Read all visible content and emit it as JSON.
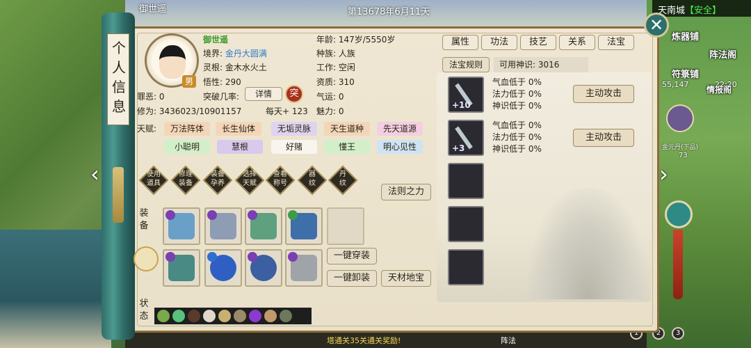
{
  "world": {
    "date": "第13678年6月11天",
    "player_tag": "御世遥",
    "bottom_notice": "塔通关35关通关奖励!",
    "bottom_tag": "阵法",
    "location": "天南城",
    "safety": "【安全】",
    "shops": [
      "炼器铺",
      "阵法阁",
      "符箓铺",
      "情报阁"
    ],
    "coords": "55,147",
    "time": "22:20",
    "npc_name": "金元丹(下品)",
    "npc_value": "73",
    "pages": [
      "1",
      "2",
      "3"
    ]
  },
  "panel_title": "个人信息",
  "character": {
    "name": "御世遥",
    "gender": "男",
    "realm_label": "境界:",
    "realm": "金丹大圆满",
    "root": "灵根: 金木水火土",
    "comprehension": "悟性: 290",
    "sin": "罪恶: 0",
    "breakthrough": "突破几率:",
    "detail_btn": "详情",
    "break_btn": "突",
    "cultivation": "修为: 3436023/10901157",
    "per_day": "每天+ 123",
    "age": "年龄: 147岁/5550岁",
    "race": "种族: 人族",
    "job": "工作: 空闲",
    "aptitude": "资质: 310",
    "luck": "气运: 0",
    "charm": "魅力: 0"
  },
  "talents": {
    "label": "天赋:",
    "items": [
      {
        "name": "万法阵体",
        "color": "#f3d6b8"
      },
      {
        "name": "长生仙体",
        "color": "#f3d6b8"
      },
      {
        "name": "无垢灵脉",
        "color": "#dfd4ef"
      },
      {
        "name": "天生道种",
        "color": "#f3d6b8"
      },
      {
        "name": "先天道源",
        "color": "#f3cfe0"
      },
      {
        "name": "小聪明",
        "color": "#d3efc9"
      },
      {
        "name": "慧根",
        "color": "#d9c9ec"
      },
      {
        "name": "好赌",
        "color": "#f8f5ee"
      },
      {
        "name": "懂王",
        "color": "#d3efc9"
      },
      {
        "name": "明心见性",
        "color": "#cfe3f2"
      }
    ]
  },
  "actions": [
    {
      "line1": "使用",
      "line2": "道具"
    },
    {
      "line1": "修理",
      "line2": "装备"
    },
    {
      "line1": "装备",
      "line2": "孕养"
    },
    {
      "line1": "选择",
      "line2": "天赋"
    },
    {
      "line1": "查看",
      "line2": "称号"
    },
    {
      "line1": "器",
      "line2": "纹"
    },
    {
      "line1": "丹",
      "line2": "纹"
    }
  ],
  "law_power": "法则之力",
  "equipment_label": "装备",
  "status_label": "状态",
  "one_click_wear": "一键穿装",
  "one_click_remove": "一键卸装",
  "treasure": "天材地宝",
  "equip_colors": {
    "slot1": "#6aa0c8",
    "slot2": "#8e9db3",
    "slot3": "#5fa07e",
    "slot4": "#3e6fa8",
    "slot6": "#4a8a84",
    "slot7": "#2f5fc2",
    "slot8": "#3b5fa0",
    "slot9": "#a0a4a8"
  },
  "tabs": [
    "属性",
    "功法",
    "技艺",
    "关系",
    "法宝"
  ],
  "fabao_rule": "法宝规则",
  "available_sense": "可用神识: 3016",
  "fabao": [
    {
      "level": "+10",
      "hp": "气血低于 0%",
      "mp": "法力低于 0%",
      "sense": "神识低于 0%",
      "button": "主动攻击"
    },
    {
      "level": "+3",
      "hp": "气血低于 0%",
      "mp": "法力低于 0%",
      "sense": "神识低于 0%",
      "button": "主动攻击"
    }
  ]
}
